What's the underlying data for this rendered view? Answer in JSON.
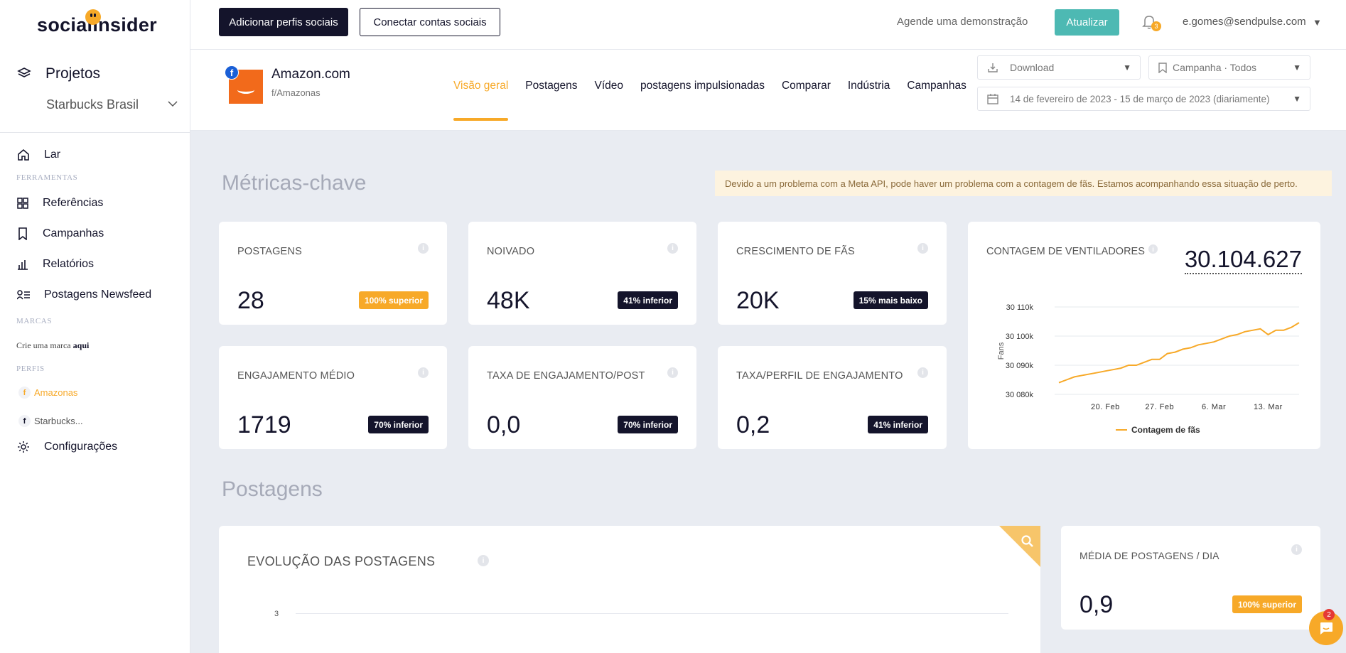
{
  "app": {
    "logo_text": "socialinsider"
  },
  "sidebar": {
    "projects_label": "Projetos",
    "project_name": "Starbucks Brasil",
    "home": "Lar",
    "tools_section": "FERRAMENTAS",
    "items": [
      {
        "label": "Referências",
        "icon": "grid-icon"
      },
      {
        "label": "Campanhas",
        "icon": "bookmark-icon"
      },
      {
        "label": "Relatórios",
        "icon": "bar-chart-icon"
      },
      {
        "label": "Postagens Newsfeed",
        "icon": "newsfeed-icon"
      }
    ],
    "brands_section": "MARCAS",
    "create_brand_prefix": "Crie uma marca",
    "create_brand_link": "aqui",
    "profiles_section": "PERFIS",
    "profiles": [
      "Amazonas",
      "Starbucks..."
    ],
    "settings": "Configurações"
  },
  "topbar": {
    "add_profiles": "Adicionar perfis sociais",
    "connect_accounts": "Conectar contas sociais",
    "demo": "Agende uma demonstração",
    "upgrade": "Atualizar",
    "notifications_count": "3",
    "user_email": "e.gomes@sendpulse.com"
  },
  "profile": {
    "name": "Amazon.com",
    "handle": "f/Amazonas",
    "tabs": [
      "Visão geral",
      "Postagens",
      "Vídeo",
      "postagens impulsionadas",
      "Comparar",
      "Indústria",
      "Campanhas"
    ],
    "active_tab": "Visão geral",
    "download": "Download",
    "campaign": "Campanha · Todos",
    "date_range": "14 de fevereiro de 2023 - 15 de março de 2023 (diariamente)"
  },
  "metrics": {
    "title": "Métricas-chave",
    "notice": "Devido a um problema com a Meta API, pode haver um problema com a contagem de fãs. Estamos acompanhando essa situação de perto.",
    "cards": [
      {
        "title": "POSTAGENS",
        "value": "28",
        "badge": "100% superior",
        "badge_color": "#f7a928"
      },
      {
        "title": "NOIVADO",
        "value": "48K",
        "badge": "41% inferior",
        "badge_color": "#14142b"
      },
      {
        "title": "CRESCIMENTO DE FÃS",
        "value": "20K",
        "badge": "15% mais baixo",
        "badge_color": "#14142b"
      },
      {
        "title": "ENGAJAMENTO MÉDIO",
        "value": "1719",
        "badge": "70% inferior",
        "badge_color": "#14142b"
      },
      {
        "title": "TAXA DE ENGAJAMENTO/POST",
        "value": "0,0",
        "badge": "70% inferior",
        "badge_color": "#14142b"
      },
      {
        "title": "TAXA/PERFIL DE ENGAJAMENTO",
        "value": "0,2",
        "badge": "41% inferior",
        "badge_color": "#14142b"
      }
    ],
    "fans": {
      "title": "CONTAGEM DE VENTILADORES",
      "value": "30.104.627"
    }
  },
  "chart_data": {
    "type": "line",
    "title": "",
    "ylabel": "Fans",
    "y_ticks": [
      "30 080k",
      "30 090k",
      "30 100k",
      "30 110k"
    ],
    "ylim": [
      30080,
      30110
    ],
    "x_ticks": [
      {
        "label": "20. Feb",
        "day": 6
      },
      {
        "label": "27. Feb",
        "day": 13
      },
      {
        "label": "6. Mar",
        "day": 20
      },
      {
        "label": "13. Mar",
        "day": 27
      }
    ],
    "x_start": "14. Feb",
    "series": [
      {
        "name": "Contagem de fãs",
        "color": "#f7a928",
        "values": [
          30084,
          30085,
          30086,
          30086.5,
          30087,
          30087.5,
          30088,
          30088.5,
          30089,
          30090,
          30090,
          30091,
          30092,
          30092,
          30094,
          30094.5,
          30095.5,
          30096,
          30097,
          30097.5,
          30098,
          30099,
          30100,
          30100.5,
          30101.5,
          30102,
          30102.5,
          30100.5,
          30102,
          30102,
          30103,
          30104.6
        ]
      }
    ]
  },
  "posts": {
    "title": "Postagens",
    "evolution_title": "EVOLUÇÃO DAS POSTAGENS",
    "evolution_tick": "3",
    "avg_title": "MÉDIA DE POSTAGENS / DIA",
    "avg_value": "0,9",
    "avg_badge": "100% superior"
  },
  "chat": {
    "badge": "2"
  }
}
